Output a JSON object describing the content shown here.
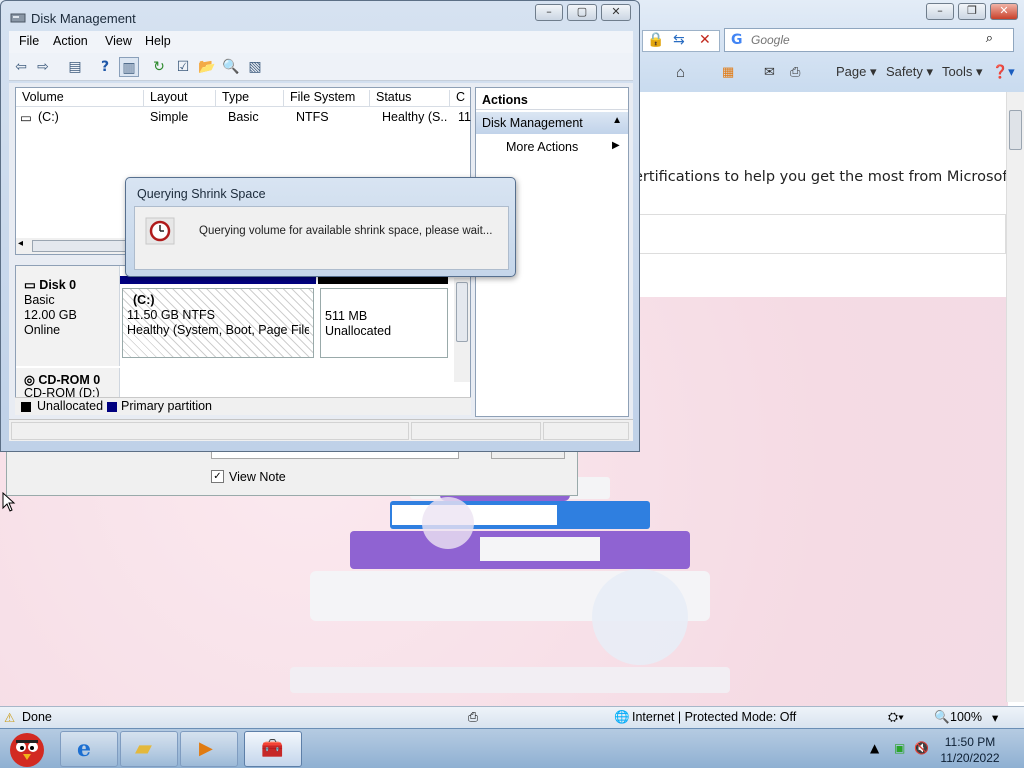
{
  "ie": {
    "search_placeholder": "Google",
    "command_bar": {
      "page": "Page",
      "safety": "Safety",
      "tools": "Tools"
    },
    "content_text": "ertifications to help you get the most from Microsoft",
    "status": {
      "left": "Done",
      "zone": "Internet | Protected Mode: Off",
      "zoom": "100%"
    }
  },
  "behind_dialog": {
    "checkbox_label": "View Note",
    "checkbox_checked": true
  },
  "disk_management": {
    "title": "Disk Management",
    "menu": [
      "File",
      "Action",
      "View",
      "Help"
    ],
    "columns": [
      "Volume",
      "Layout",
      "Type",
      "File System",
      "Status",
      "C"
    ],
    "volumes": [
      {
        "volume": "(C:)",
        "layout": "Simple",
        "type": "Basic",
        "file_system": "NTFS",
        "status": "Healthy (S...",
        "capacity": "11"
      }
    ],
    "disks": [
      {
        "name": "Disk 0",
        "kind": "Basic",
        "size": "12.00 GB",
        "state": "Online",
        "partitions": [
          {
            "label": "(C:)",
            "size": "11.50 GB NTFS",
            "status": "Healthy (System, Boot, Page File, A"
          },
          {
            "label": "",
            "size": "511 MB",
            "status": "Unallocated"
          }
        ]
      },
      {
        "name": "CD-ROM 0",
        "kind": "CD-ROM (D:)"
      }
    ],
    "legend": [
      "Unallocated",
      "Primary partition"
    ],
    "actions": {
      "header": "Actions",
      "section": "Disk Management",
      "more": "More Actions"
    }
  },
  "shrink_dialog": {
    "title": "Querying Shrink Space",
    "message": "Querying volume for available shrink space, please wait..."
  },
  "taskbar": {
    "time": "11:50 PM",
    "date": "11/20/2022"
  },
  "colors": {
    "primary_partition": "#000080",
    "unallocated": "#000000",
    "title_bar": "#c9dbef"
  }
}
